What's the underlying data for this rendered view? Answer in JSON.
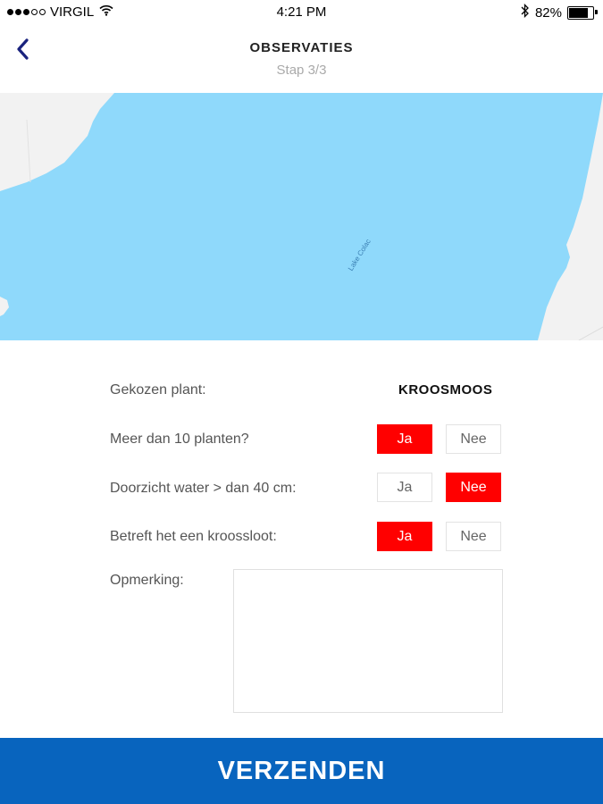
{
  "status_bar": {
    "carrier": "VIRGIL",
    "time": "4:21 PM",
    "battery": "82%",
    "battery_level": 0.82,
    "icons": [
      "signal-dots-icon",
      "wifi-icon",
      "bluetooth-icon",
      "battery-icon"
    ]
  },
  "header": {
    "title": "OBSERVATIES",
    "subtitle": "Stap 3/3",
    "back_icon": "chevron-left-icon",
    "accent_color": "#1a237e"
  },
  "map": {
    "lake_label": "Lake Colac",
    "water_color": "#8fd9fb",
    "land_color": "#f2f2f2"
  },
  "form": {
    "plant_label": "Gekozen plant:",
    "plant_value": "KROOSMOOS",
    "questions": [
      {
        "label": "Meer dan 10 planten?",
        "yes": "Ja",
        "no": "Nee",
        "selected": "yes"
      },
      {
        "label": "Doorzicht water > dan 40 cm:",
        "yes": "Ja",
        "no": "Nee",
        "selected": "no"
      },
      {
        "label": "Betreft het een kroossloot:",
        "yes": "Ja",
        "no": "Nee",
        "selected": "yes"
      }
    ],
    "remark_label": "Opmerking:",
    "remark_value": "",
    "active_color": "#ff0000"
  },
  "submit": {
    "label": "VERZENDEN",
    "color": "#0864be"
  }
}
